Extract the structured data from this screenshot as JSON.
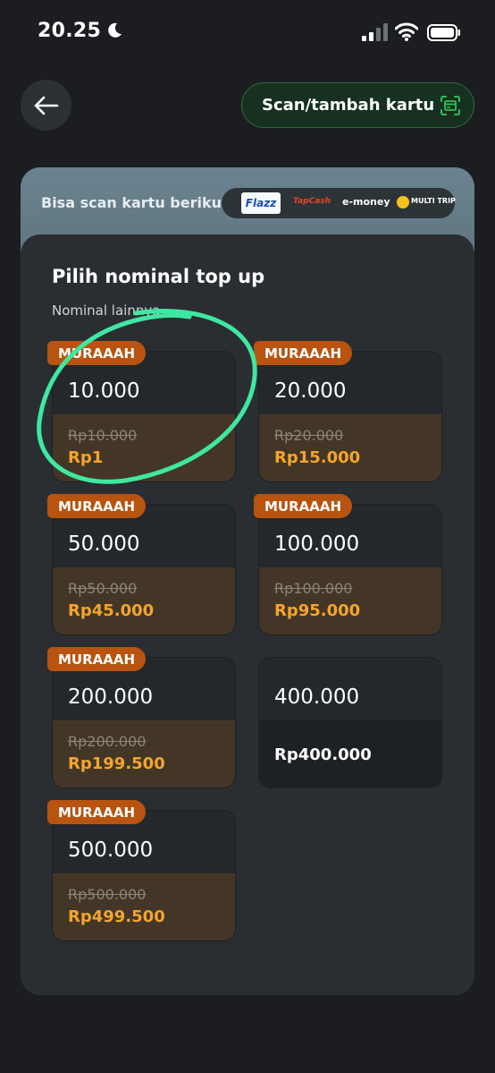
{
  "status_bar": {
    "time": "20.25"
  },
  "header": {
    "scan_button_label": "Scan/tambah kartu"
  },
  "supported_cards": {
    "label": "Bisa scan kartu berikut",
    "logos": {
      "flazz": "Flazz",
      "tapcash": "TapCash",
      "emoney": "e-money",
      "multitrip": "MULTI TRIP"
    }
  },
  "topup": {
    "title": "Pilih nominal top up",
    "subtitle": "Nominal lainnya",
    "tiles": [
      {
        "badge": "MURAAAH",
        "amount": "10.000",
        "old_price": "Rp10.000",
        "price": "Rp1"
      },
      {
        "badge": "MURAAAH",
        "amount": "20.000",
        "old_price": "Rp20.000",
        "price": "Rp15.000"
      },
      {
        "badge": "MURAAAH",
        "amount": "50.000",
        "old_price": "Rp50.000",
        "price": "Rp45.000"
      },
      {
        "badge": "MURAAAH",
        "amount": "100.000",
        "old_price": "Rp100.000",
        "price": "Rp95.000"
      },
      {
        "badge": "MURAAAH",
        "amount": "200.000",
        "old_price": "Rp200.000",
        "price": "Rp199.500"
      },
      {
        "amount": "400.000",
        "price": "Rp400.000"
      },
      {
        "badge": "MURAAAH",
        "amount": "500.000",
        "old_price": "Rp500.000",
        "price": "Rp499.500"
      }
    ]
  },
  "colors": {
    "background": "#1b1d20",
    "badge": "#b85410",
    "discount_price": "#f4a52b",
    "scan_accent": "#2fbf5a",
    "annotation_stroke": "#3ee8a0"
  }
}
